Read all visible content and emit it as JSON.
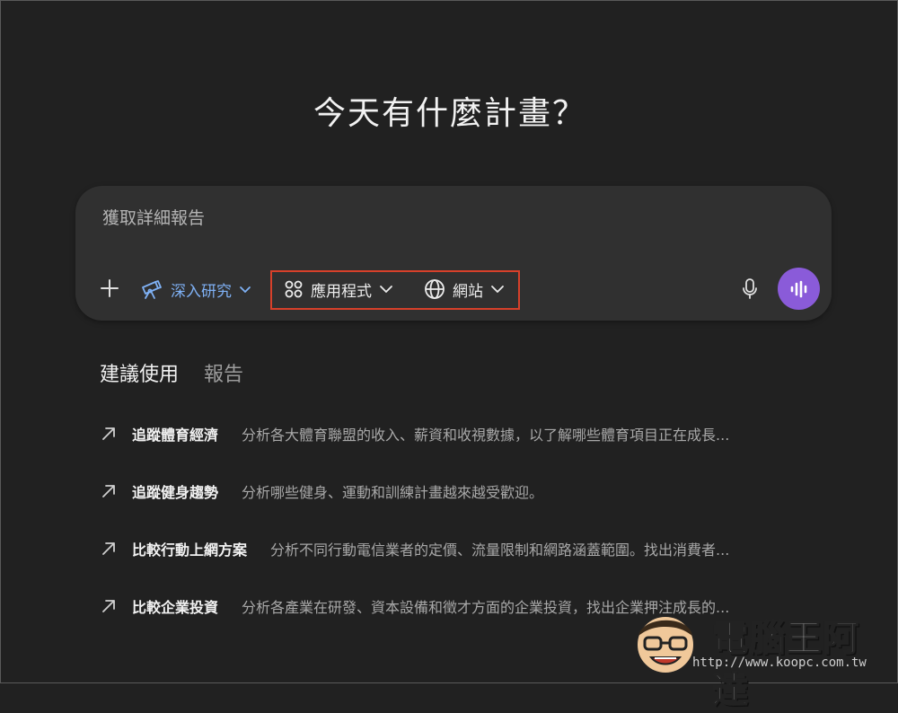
{
  "headline": "今天有什麼計畫？",
  "composer": {
    "placeholder": "獲取詳細報告",
    "deep_research_label": "深入研究",
    "apps_label": "應用程式",
    "web_label": "網站"
  },
  "tabs": {
    "suggested": "建議使用",
    "reports": "報告"
  },
  "suggestions": [
    {
      "title": "追蹤體育經濟",
      "desc": "分析各大體育聯盟的收入、薪資和收視數據，以了解哪些體育項目正在成長..."
    },
    {
      "title": "追蹤健身趨勢",
      "desc": "分析哪些健身、運動和訓練計畫越來越受歡迎。"
    },
    {
      "title": "比較行動上網方案",
      "desc": "分析不同行動電信業者的定價、流量限制和網路涵蓋範圍。找出消費者..."
    },
    {
      "title": "比較企業投資",
      "desc": "分析各產業在研發、資本設備和徵才方面的企業投資，找出企業押注成長的..."
    }
  ],
  "watermark": {
    "brand": "電腦王阿達",
    "url": "http://www.koopc.com.tw"
  },
  "colors": {
    "background": "#212121",
    "composer": "#303030",
    "accent_blue": "#7fb1f5",
    "voice_button": "#8a5bd9",
    "highlight_box": "#d7402a"
  }
}
